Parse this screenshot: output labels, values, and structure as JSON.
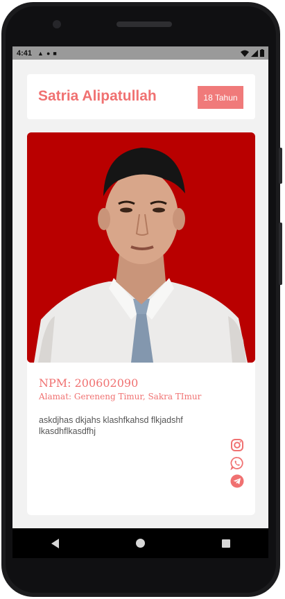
{
  "status_bar": {
    "time": "4:41"
  },
  "header": {
    "name": "Satria Alipatullah",
    "age_badge": "18 Tahun"
  },
  "profile": {
    "npm": "NPM: 200602090",
    "address": "Alamat: Gereneng Timur, Sakra TImur",
    "description": "askdjhas dkjahs klashfkahsd flkjadshf lkasdhflkasdfhj"
  },
  "socials": [
    "instagram-icon",
    "whatsapp-icon",
    "telegram-icon"
  ],
  "colors": {
    "accent": "#f07171",
    "photo_bg": "#b90000",
    "app_bg": "#f2f2f2"
  }
}
